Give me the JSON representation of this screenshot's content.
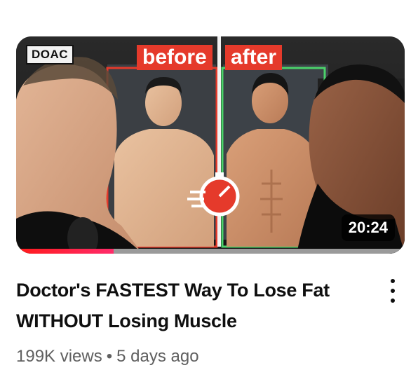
{
  "video": {
    "thumbnail": {
      "badge": "DOAC",
      "label_before": "before",
      "label_after": "after",
      "duration": "20:24",
      "watch_progress_fraction": 0.25
    },
    "title_line1": "Doctor's FASTEST Way To Lose Fat",
    "title_line2": "WITHOUT Losing Muscle",
    "views": "199K views",
    "separator": "•",
    "age": "5 days ago",
    "menu_icon": "more-vertical-icon"
  },
  "colors": {
    "label_red": "#e53a2b",
    "progress_red": "#ff1a1a",
    "title_text": "#0f0f0f",
    "meta_text": "#606060"
  }
}
